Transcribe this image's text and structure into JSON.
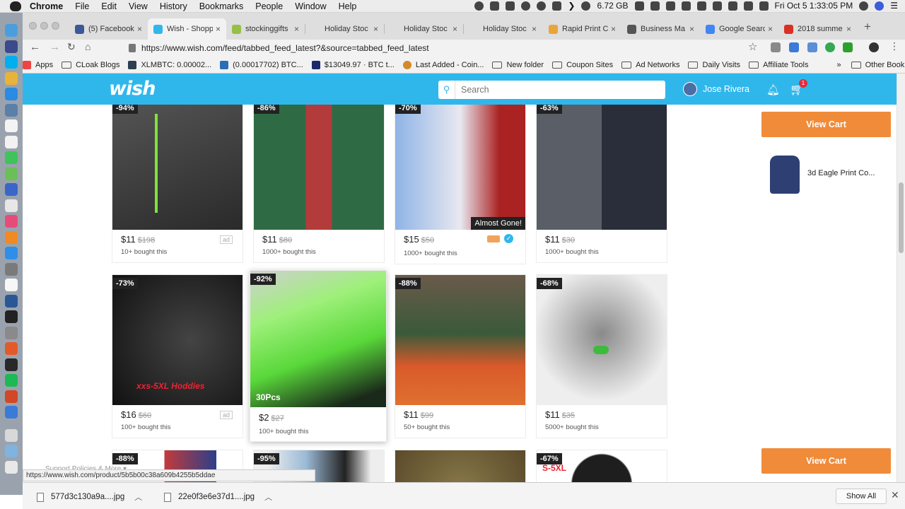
{
  "menubar": {
    "app": "Chrome",
    "items": [
      "File",
      "Edit",
      "View",
      "History",
      "Bookmarks",
      "People",
      "Window",
      "Help"
    ],
    "memory": "6.72 GB",
    "clock": "Fri Oct 5  1:33:05 PM"
  },
  "tabs": [
    {
      "title": "(5) Facebook",
      "color": "#3b5998"
    },
    {
      "title": "Wish - Shopp",
      "color": "#2fb7ec",
      "active": true
    },
    {
      "title": "stockinggifts",
      "color": "#95bf47"
    },
    {
      "title": "Holiday Stoc",
      "color": "#cccccc"
    },
    {
      "title": "Holiday Stoc",
      "color": "#cccccc"
    },
    {
      "title": "Holiday Stoc",
      "color": "#cccccc"
    },
    {
      "title": "Rapid Print C",
      "color": "#e9a43c"
    },
    {
      "title": "Business Ma",
      "color": "#555555"
    },
    {
      "title": "Google Searc",
      "color": "#4285f4"
    },
    {
      "title": "2018 summe",
      "color": "#d93025"
    }
  ],
  "address": {
    "url": "https://www.wish.com/feed/tabbed_feed_latest?&source=tabbed_feed_latest"
  },
  "bookmarks": {
    "items": [
      {
        "label": "Apps",
        "type": "apps"
      },
      {
        "label": "CLoak Blogs",
        "type": "folder"
      },
      {
        "label": "XLMBTC: 0.00002...",
        "type": "link"
      },
      {
        "label": "(0.00017702) BTC...",
        "type": "link"
      },
      {
        "label": "$13049.97 · BTC t...",
        "type": "link"
      },
      {
        "label": "Last Added - Coin...",
        "type": "link"
      },
      {
        "label": "New folder",
        "type": "folder"
      },
      {
        "label": "Coupon Sites",
        "type": "folder"
      },
      {
        "label": "Ad Networks",
        "type": "folder"
      },
      {
        "label": "Daily Visits",
        "type": "folder"
      },
      {
        "label": "Affiliate Tools",
        "type": "folder"
      }
    ],
    "more": "»",
    "other": "Other Bookmarks"
  },
  "wish": {
    "logo": "wish",
    "search_placeholder": "Search",
    "user": "Jose Rivera",
    "cart_count": "1",
    "view_cart": "View Cart",
    "cart_item": "3d Eagle Print Co..."
  },
  "products_row1": [
    {
      "disc": "-94%",
      "price": "$11",
      "orig": "$198",
      "bought": "10+ bought this",
      "ad": "ad",
      "bg": "#3a3a3a"
    },
    {
      "disc": "-86%",
      "price": "$11",
      "orig": "$80",
      "bought": "1000+ bought this",
      "bg": "#b33b3b"
    },
    {
      "disc": "-70%",
      "price": "$15",
      "orig": "$50",
      "bought": "1000+ bought this",
      "almost": "Almost Gone!",
      "bg": "#6c7fae"
    },
    {
      "disc": "-63%",
      "price": "$11",
      "orig": "$30",
      "bought": "1000+ bought this",
      "bg": "#555b66"
    }
  ],
  "products_row2": [
    {
      "disc": "-73%",
      "price": "$16",
      "orig": "$60",
      "bought": "100+ bought this",
      "ad": "ad",
      "overlay": "xxs-5XL Hoddies",
      "bg": "#2b2b2b"
    },
    {
      "disc": "-92%",
      "price": "$2",
      "orig": "$27",
      "bought": "100+ bought this",
      "overlay": "30Pcs",
      "bg": "#6fe35a"
    },
    {
      "disc": "-88%",
      "price": "$11",
      "orig": "$99",
      "bought": "50+ bought this",
      "bg": "#5a6a55"
    },
    {
      "disc": "-68%",
      "price": "$11",
      "orig": "$35",
      "bought": "5000+ bought this",
      "bg": "#cfcfcf"
    }
  ],
  "products_row3": [
    {
      "disc": "-88%",
      "bg": "#c23b3b"
    },
    {
      "disc": "-95%",
      "bg": "#9bbad6"
    },
    {
      "disc": "",
      "bg": "#8a7a4a"
    },
    {
      "disc": "-67%",
      "overlay": "S-5XL",
      "bg": "#1e1e1e"
    }
  ],
  "footer": {
    "links": "Support  Policies  & More ▾"
  },
  "status_url": "https://www.wish.com/product/5b5b00c38a609b4255b5ddae",
  "downloads": {
    "files": [
      "577d3c130a9a....jpg",
      "22e0f3e6e37d1....jpg"
    ],
    "show_all": "Show All"
  }
}
